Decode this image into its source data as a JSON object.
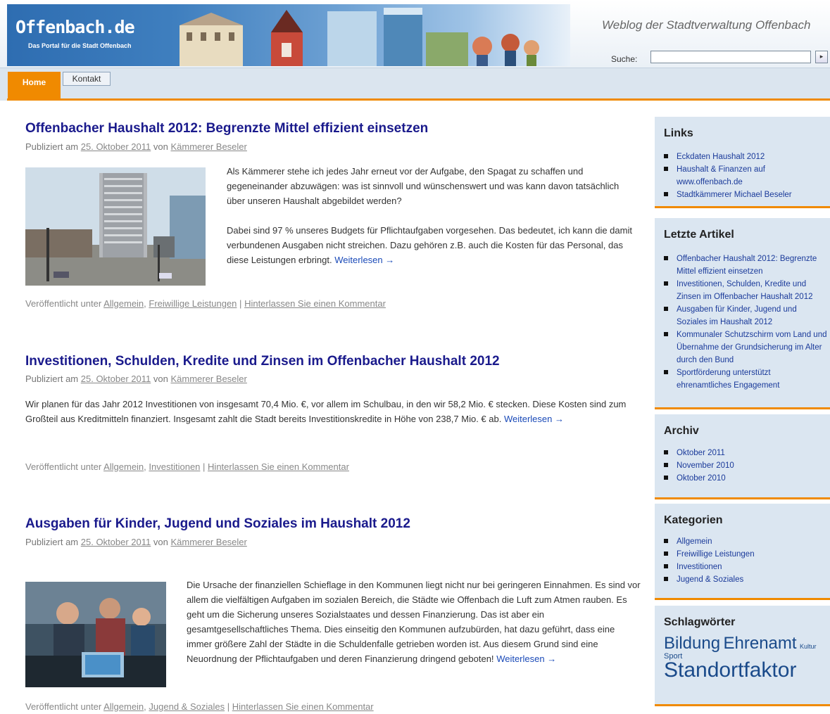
{
  "header": {
    "logo_title": "Offenbach.de",
    "logo_subtitle": "Das Portal für die Stadt Offenbach",
    "tagline": "Weblog der Stadtverwaltung Offenbach",
    "search_label": "Suche:",
    "search_value": "",
    "search_button": "▸"
  },
  "nav": {
    "tabs": [
      {
        "label": "Home"
      },
      {
        "label": "Kontakt"
      }
    ]
  },
  "posts": [
    {
      "title": "Offenbacher Haushalt 2012: Begrenzte Mittel effizient einsetzen",
      "meta_prefix": "Publiziert am",
      "date": "25. Oktober 2011",
      "meta_by": "von",
      "author": "Kämmerer Beseler",
      "paragraphs": [
        "Als Kämmerer stehe ich jedes Jahr erneut vor der Aufgabe, den Spagat zu schaffen und gegeneinander abzuwägen: was ist sinnvoll und wünschenswert und was kann davon tatsächlich über unseren Haushalt abgebildet werden?",
        "Dabei sind 97 % unseres Budgets für Pflichtaufgaben vorgesehen. Das bedeutet, ich kann die damit verbundenen Ausgaben nicht streichen. Dazu gehören z.B. auch die Kosten für das Personal, das diese Leistungen erbringt."
      ],
      "read_more": "Weiterlesen →",
      "foot_prefix": "Veröffentlicht unter",
      "categories": [
        "Allgemein",
        "Freiwillige Leistungen"
      ],
      "separator": "|",
      "comment": "Hinterlassen Sie einen Kommentar"
    },
    {
      "title": "Investitionen, Schulden, Kredite und Zinsen im Offenbacher Haushalt 2012",
      "meta_prefix": "Publiziert am",
      "date": "25. Oktober 2011",
      "meta_by": "von",
      "author": "Kämmerer Beseler",
      "paragraphs": [
        "Wir planen für das Jahr 2012 Investitionen von insgesamt 70,4 Mio. €, vor allem im Schulbau, in den wir 58,2 Mio. € stecken. Diese Kosten sind zum Großteil aus Kreditmitteln finanziert. Insgesamt zahlt die Stadt bereits Investitionskredite in Höhe von 238,7 Mio. € ab."
      ],
      "read_more": "Weiterlesen →",
      "foot_prefix": "Veröffentlicht unter",
      "categories": [
        "Allgemein",
        "Investitionen"
      ],
      "separator": "|",
      "comment": "Hinterlassen Sie einen Kommentar"
    },
    {
      "title": "Ausgaben für Kinder, Jugend und Soziales im Haushalt 2012",
      "meta_prefix": "Publiziert am",
      "date": "25. Oktober 2011",
      "meta_by": "von",
      "author": "Kämmerer Beseler",
      "paragraphs": [
        "Die Ursache der finanziellen Schieflage in den Kommunen liegt nicht nur bei geringeren Einnahmen. Es sind vor allem die vielfältigen Aufgaben im sozialen Bereich, die Städte wie Offenbach die Luft zum Atmen rauben. Es geht um die Sicherung unseres Sozialstaates und dessen Finanzierung. Das ist aber ein gesamtgesellschaftliches Thema. Dies einseitig den Kommunen aufzubürden, hat dazu geführt, dass eine immer größere Zahl der Städte in die Schuldenfalle getrieben worden ist. Aus diesem Grund sind eine Neuordnung der Pflichtaufgaben und deren Finanzierung dringend geboten!"
      ],
      "read_more": "Weiterlesen →",
      "foot_prefix": "Veröffentlicht unter",
      "categories": [
        "Allgemein",
        "Jugend & Soziales"
      ],
      "separator": "|",
      "comment": "Hinterlassen Sie einen Kommentar"
    }
  ],
  "sidebar": {
    "links": {
      "title": "Links",
      "items": [
        "Eckdaten Haushalt 2012",
        "Haushalt & Finanzen auf www.offenbach.de",
        "Stadtkämmerer Michael Beseler"
      ]
    },
    "recent": {
      "title": "Letzte Artikel",
      "items": [
        "Offenbacher Haushalt 2012: Begrenzte Mittel effizient einsetzen",
        "Investitionen, Schulden, Kredite und Zinsen im Offenbacher Haushalt 2012",
        "Ausgaben für Kinder, Jugend und Soziales im Haushalt 2012",
        "Kommunaler Schutzschirm vom Land und Übernahme der Grundsicherung im Alter durch den Bund",
        "Sportförderung unterstützt ehrenamtliches Engagement"
      ]
    },
    "archive": {
      "title": "Archiv",
      "items": [
        "Oktober 2011",
        "November 2010",
        "Oktober 2010"
      ]
    },
    "categories": {
      "title": "Kategorien",
      "items": [
        "Allgemein",
        "Freiwillige Leistungen",
        "Investitionen",
        "Jugend & Soziales"
      ]
    },
    "tags": {
      "title": "Schlagwörter",
      "items": [
        "Bildung",
        "Ehrenamt",
        "Kultur",
        "Sport",
        "Standortfaktor"
      ]
    }
  },
  "colors": {
    "accent": "#f08a00",
    "title_blue": "#1a1a8c",
    "sidebar_bg": "#dbe6f1",
    "banner_blue": "#2e6db1"
  }
}
